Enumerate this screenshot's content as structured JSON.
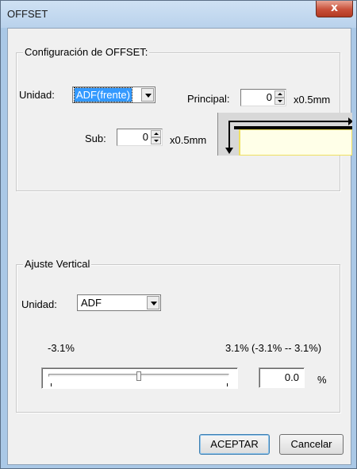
{
  "window": {
    "title": "OFFSET",
    "close_glyph": "x"
  },
  "offset_group": {
    "legend": "Configuración de OFFSET:",
    "unit_label": "Unidad:",
    "unit_value": "ADF(frente)",
    "principal_label": "Principal:",
    "principal_value": "0",
    "principal_unit": "x0.5mm",
    "sub_label": "Sub:",
    "sub_value": "0",
    "sub_unit": "x0.5mm"
  },
  "vertical_group": {
    "legend": "Ajuste Vertical",
    "unit_label": "Unidad:",
    "unit_value": "ADF",
    "min_label": "-3.1%",
    "max_label": "3.1%",
    "range_label": "(-3.1% -- 3.1%)",
    "slider_value": 0.0,
    "value_text": "0.0",
    "percent_sign": "%"
  },
  "buttons": {
    "ok": "ACEPTAR",
    "cancel": "Cancelar"
  },
  "colors": {
    "selection": "#3399ff",
    "preview_paper": "#ffffe8",
    "preview_border": "#f0e060"
  }
}
